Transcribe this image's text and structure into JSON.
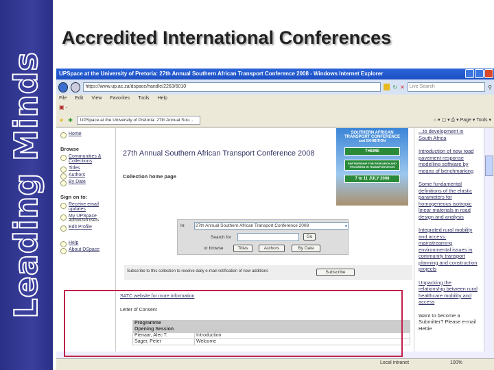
{
  "slide": {
    "brand": "Leading Minds",
    "title": "Accredited International Conferences"
  },
  "browser": {
    "window_title": "UPSpace at the University of Pretoria: 27th Annual Southern African Transport Conference 2008 - Windows Internet Explorer",
    "url": "https://www.up.ac.za/dspace/handle/2263/6010",
    "search_placeholder": "Live Search",
    "menu": [
      "File",
      "Edit",
      "View",
      "Favorites",
      "Tools",
      "Help"
    ],
    "tab": "UPSpace at the University of Pretoria: 27th Annual Sou...",
    "tools": "Page ▾  Tools ▾",
    "status_zone": "Local intranet",
    "zoom": "100%"
  },
  "nav": {
    "home": "Home",
    "browse": "Browse",
    "communities": "Communities & Collections",
    "titles": "Titles",
    "authors": "Authors",
    "by_date": "By Date",
    "sign_on": "Sign on to:",
    "receive": "Receive email updates",
    "my": "My UPSpace",
    "authorized": "authorized users",
    "edit": "Edit Profile",
    "help": "Help",
    "about": "About DSpace"
  },
  "main": {
    "title": "27th Annual Southern African Transport Conference 2008",
    "subtitle": "Collection home page",
    "poster": {
      "line1": "SOUTHERN AFRICAN",
      "line2": "TRANSPORT CONFERENCE",
      "line3": "and EXHIBITION",
      "sign1": "THEME",
      "sign2": "PARTNERSHIP FOR RESEARCH AND PROGRESS IN TRANSPORTATION",
      "sign3": "7 to 11 JULY 2008"
    },
    "search": {
      "in_label": "In:",
      "scope": "27th Annual Southern African Transport Conference 2008",
      "search_for": "Search for",
      "go": "Go",
      "or_browse": "or browse",
      "titles": "Titles",
      "authors": "Authors",
      "by_date": "By Date"
    },
    "subscribe_text": "Subscribe to this collection to receive daily e-mail notification of new additions",
    "subscribe": "Subscribe",
    "link": "SATC website for more information",
    "letter": "Letter of Consent",
    "table": [
      [
        "Programme",
        ""
      ],
      [
        "Opening Session",
        ""
      ],
      [
        "Pienaar, Alec T.",
        "Introduction"
      ],
      [
        "Sager, Peter",
        "Welcome"
      ]
    ]
  },
  "right": [
    "...to development in South Africa",
    "Introduction of new road pavement response modelling software by means of benchmarking",
    "Some fundamental definitions of the elastic parameters for homogeneous isotropic linear materials in road design and analysis",
    "Integrated rural mobility and access: mainstreaming environmental issues in community transport planning and construction projects",
    "Unpacking the relationship between rural healthcare mobility and access",
    "Want to become a Submitter? Please e-mail Hettie"
  ]
}
